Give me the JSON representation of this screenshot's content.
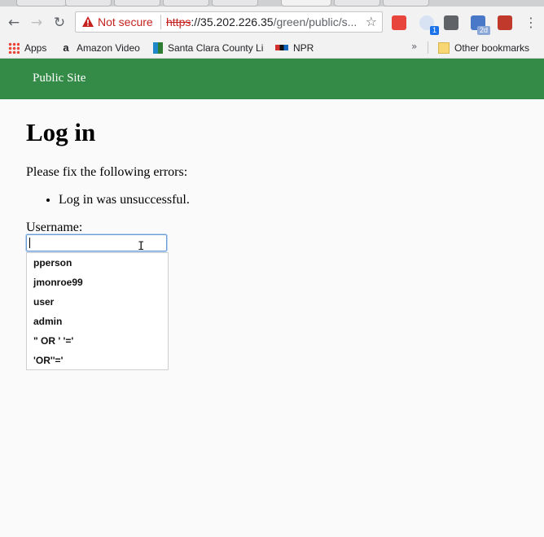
{
  "browser": {
    "security_label": "Not secure",
    "url_scheme": "https",
    "url_host": "://35.202.226.35",
    "url_path": "/green/public/s...",
    "extension_badges": {
      "phone": "1",
      "calendar": "2d"
    }
  },
  "bookmarks": {
    "items": [
      {
        "label": "Apps"
      },
      {
        "label": "Amazon Video"
      },
      {
        "label": "Santa Clara County Li"
      },
      {
        "label": "NPR"
      }
    ],
    "more": "»",
    "other": "Other bookmarks"
  },
  "site": {
    "brand": "Public Site",
    "title": "Log in",
    "errors_intro": "Please fix the following errors:",
    "errors": [
      "Log in was unsuccessful."
    ],
    "username_label": "Username:",
    "username_value": ""
  },
  "autocomplete": [
    "pperson",
    "jmonroe99",
    "user",
    "admin",
    "\" OR ' '='",
    "'OR''='"
  ],
  "colors": {
    "header_green": "#348b48",
    "insecure_red": "#c5221f"
  }
}
